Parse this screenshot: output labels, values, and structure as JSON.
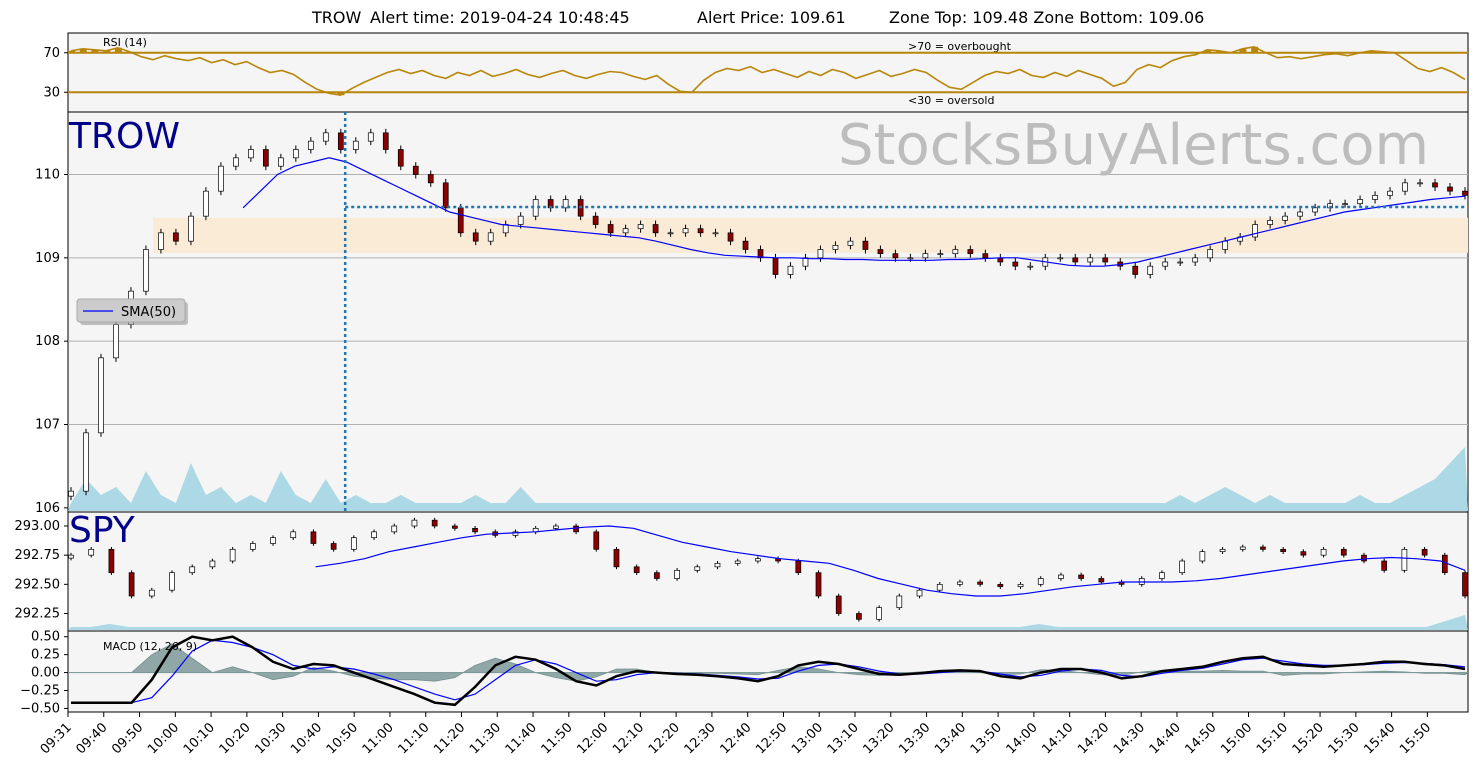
{
  "header": {
    "symbol": "TROW",
    "alert_time": "Alert time: 2019-04-24 10:48:45",
    "alert_price": "Alert Price: 109.61",
    "zone": "Zone Top: 109.48  Zone Bottom: 109.06"
  },
  "watermark": "StocksBuyAlerts.com",
  "colors": {
    "rsi_line": "#b8860b",
    "sma": "#0000ff",
    "volume": "#add8e6",
    "zone": "#faebd7",
    "alert_line": "#1f77b4",
    "macd_hist": "#7f9a9a",
    "panel_bg": "#f5f5f5"
  },
  "chart_data": [
    {
      "name": "rsi",
      "type": "line",
      "label": "RSI (14)",
      "yticks": [
        "70",
        "30"
      ],
      "ylim": [
        10,
        90
      ],
      "overbought_label": ">70 = overbought",
      "oversold_label": "<30 = oversold",
      "overbought": 70,
      "oversold": 30,
      "values": [
        72,
        74,
        73,
        72,
        75,
        71,
        66,
        63,
        67,
        64,
        62,
        65,
        60,
        63,
        58,
        61,
        55,
        50,
        52,
        48,
        40,
        33,
        29,
        27,
        34,
        40,
        45,
        50,
        53,
        49,
        52,
        47,
        44,
        50,
        47,
        52,
        46,
        49,
        53,
        48,
        45,
        49,
        52,
        47,
        44,
        48,
        51,
        50,
        46,
        43,
        47,
        38,
        31,
        30,
        42,
        50,
        54,
        52,
        56,
        50,
        53,
        49,
        45,
        51,
        47,
        53,
        50,
        44,
        48,
        52,
        46,
        49,
        53,
        50,
        42,
        35,
        33,
        40,
        47,
        51,
        49,
        53,
        47,
        45,
        50,
        46,
        52,
        48,
        44,
        36,
        40,
        53,
        58,
        55,
        62,
        66,
        68,
        73,
        72,
        70,
        74,
        76,
        70,
        65,
        66,
        64,
        66,
        68,
        69,
        67,
        70,
        72,
        71,
        70,
        62,
        54,
        51,
        55,
        50,
        43
      ]
    },
    {
      "name": "trow",
      "type": "candlestick",
      "label": "TROW",
      "yticks": [
        "110",
        "109",
        "108",
        "107",
        "106"
      ],
      "ylim": [
        105.95,
        110.75
      ],
      "zone_top": 109.48,
      "zone_bottom": 109.06,
      "alert_price": 109.61,
      "alert_time": "10:48",
      "legend": "SMA(50)",
      "closes": [
        106.2,
        106.9,
        107.8,
        108.2,
        108.6,
        109.1,
        109.3,
        109.2,
        109.5,
        109.8,
        110.1,
        110.2,
        110.3,
        110.1,
        110.2,
        110.3,
        110.4,
        110.5,
        110.3,
        110.4,
        110.5,
        110.3,
        110.1,
        110.0,
        109.9,
        109.6,
        109.3,
        109.2,
        109.3,
        109.4,
        109.5,
        109.7,
        109.6,
        109.7,
        109.5,
        109.4,
        109.3,
        109.35,
        109.4,
        109.3,
        109.3,
        109.35,
        109.3,
        109.3,
        109.2,
        109.1,
        109.0,
        108.8,
        108.9,
        109.0,
        109.1,
        109.15,
        109.2,
        109.1,
        109.05,
        109.0,
        109.0,
        109.05,
        109.05,
        109.1,
        109.05,
        109.0,
        108.95,
        108.9,
        108.9,
        109.0,
        109.0,
        108.95,
        109.0,
        108.95,
        108.9,
        108.8,
        108.9,
        108.95,
        108.95,
        109.0,
        109.1,
        109.2,
        109.25,
        109.4,
        109.45,
        109.5,
        109.55,
        109.6,
        109.65,
        109.65,
        109.7,
        109.75,
        109.8,
        109.9,
        109.9,
        109.85,
        109.8,
        109.75
      ],
      "sma": [
        null,
        null,
        null,
        null,
        null,
        null,
        null,
        null,
        null,
        null,
        109.6,
        109.8,
        110.0,
        110.1,
        110.15,
        110.2,
        110.15,
        110.05,
        109.95,
        109.85,
        109.75,
        109.65,
        109.55,
        109.5,
        109.45,
        109.4,
        109.38,
        109.36,
        109.34,
        109.32,
        109.3,
        109.28,
        109.26,
        109.24,
        109.2,
        109.15,
        109.1,
        109.06,
        109.03,
        109.02,
        109.01,
        109.0,
        109.0,
        108.99,
        108.99,
        108.98,
        108.98,
        108.97,
        108.97,
        108.97,
        108.97,
        108.98,
        108.98,
        108.99,
        109.0,
        109.0,
        108.97,
        108.94,
        108.91,
        108.9,
        108.9,
        108.92,
        108.95,
        109.0,
        109.05,
        109.1,
        109.15,
        109.2,
        109.25,
        109.3,
        109.35,
        109.4,
        109.45,
        109.5,
        109.55,
        109.58,
        109.61,
        109.64,
        109.67,
        109.7,
        109.72,
        109.74
      ],
      "volume": [
        1,
        4,
        2,
        3,
        1,
        5,
        2,
        1,
        6,
        2,
        3,
        1,
        2,
        1,
        5,
        2,
        1,
        4,
        1,
        2,
        1,
        1,
        2,
        1,
        1,
        1,
        1,
        2,
        1,
        1,
        3,
        1,
        1,
        1,
        1,
        1,
        1,
        1,
        1,
        1,
        1,
        1,
        1,
        1,
        1,
        1,
        1,
        1,
        1,
        1,
        1,
        1,
        1,
        1,
        1,
        1,
        1,
        1,
        1,
        1,
        1,
        1,
        1,
        1,
        1,
        1,
        1,
        1,
        1,
        1,
        1,
        1,
        1,
        1,
        2,
        1,
        2,
        3,
        2,
        1,
        2,
        1,
        1,
        1,
        1,
        1,
        2,
        1,
        1,
        2,
        3,
        4,
        6,
        8
      ]
    },
    {
      "name": "spy",
      "type": "candlestick",
      "label": "SPY",
      "yticks": [
        "293.00",
        "292.75",
        "292.50",
        "292.25"
      ],
      "ylim": [
        292.1,
        293.12
      ],
      "closes": [
        292.75,
        292.8,
        292.6,
        292.4,
        292.45,
        292.6,
        292.65,
        292.7,
        292.8,
        292.85,
        292.9,
        292.95,
        292.85,
        292.8,
        292.9,
        292.95,
        293.0,
        293.05,
        293.0,
        292.98,
        292.95,
        292.92,
        292.95,
        292.98,
        293.0,
        292.95,
        292.8,
        292.65,
        292.6,
        292.55,
        292.62,
        292.65,
        292.68,
        292.7,
        292.72,
        292.7,
        292.6,
        292.4,
        292.25,
        292.2,
        292.3,
        292.4,
        292.45,
        292.5,
        292.52,
        292.5,
        292.48,
        292.5,
        292.55,
        292.58,
        292.55,
        292.52,
        292.5,
        292.55,
        292.6,
        292.7,
        292.78,
        292.8,
        292.82,
        292.8,
        292.78,
        292.75,
        292.8,
        292.75,
        292.7,
        292.62,
        292.8,
        292.75,
        292.6,
        292.4
      ],
      "sma": [
        null,
        null,
        null,
        null,
        null,
        null,
        null,
        null,
        null,
        null,
        292.65,
        292.68,
        292.72,
        292.78,
        292.82,
        292.86,
        292.9,
        292.93,
        292.94,
        292.95,
        292.97,
        292.99,
        293.0,
        292.98,
        292.92,
        292.86,
        292.82,
        292.78,
        292.75,
        292.72,
        292.7,
        292.68,
        292.62,
        292.55,
        292.5,
        292.45,
        292.42,
        292.4,
        292.4,
        292.42,
        292.45,
        292.48,
        292.5,
        292.52,
        292.52,
        292.52,
        292.53,
        292.55,
        292.58,
        292.61,
        292.64,
        292.67,
        292.7,
        292.72,
        292.73,
        292.72,
        292.7,
        292.62
      ],
      "volume": [
        1,
        1,
        2,
        1,
        1,
        1,
        1,
        1,
        1,
        1,
        1,
        1,
        1,
        1,
        1,
        1,
        1,
        1,
        1,
        1,
        1,
        1,
        1,
        1,
        1,
        1,
        1,
        1,
        1,
        1,
        1,
        1,
        1,
        1,
        1,
        1,
        1,
        1,
        1,
        1,
        1,
        1,
        1,
        1,
        1,
        1,
        1,
        1,
        1,
        1,
        2,
        1,
        1,
        1,
        1,
        1,
        1,
        1,
        1,
        1,
        1,
        1,
        1,
        1,
        1,
        1,
        1,
        1,
        1,
        1,
        1,
        3,
        5
      ]
    },
    {
      "name": "macd",
      "type": "line",
      "label": "MACD (12, 26, 9)",
      "yticks": [
        "0.50",
        "0.25",
        "0.00",
        "−0.25",
        "−0.50"
      ],
      "ylim": [
        -0.55,
        0.58
      ],
      "macd": [
        -0.42,
        -0.42,
        -0.42,
        -0.42,
        -0.1,
        0.35,
        0.5,
        0.45,
        0.5,
        0.35,
        0.15,
        0.05,
        0.12,
        0.1,
        0.0,
        -0.1,
        -0.2,
        -0.3,
        -0.42,
        -0.45,
        -0.2,
        0.1,
        0.22,
        0.18,
        0.05,
        -0.12,
        -0.18,
        -0.05,
        0.02,
        0.0,
        -0.02,
        -0.03,
        -0.05,
        -0.08,
        -0.12,
        -0.05,
        0.1,
        0.15,
        0.12,
        0.05,
        -0.02,
        -0.03,
        -0.01,
        0.02,
        0.03,
        0.02,
        -0.05,
        -0.08,
        0.0,
        0.05,
        0.05,
        0.0,
        -0.08,
        -0.05,
        0.02,
        0.05,
        0.08,
        0.15,
        0.2,
        0.22,
        0.12,
        0.1,
        0.08,
        0.1,
        0.12,
        0.15,
        0.15,
        0.12,
        0.1,
        0.05
      ],
      "signal": [
        -0.42,
        -0.42,
        -0.42,
        -0.42,
        -0.35,
        -0.05,
        0.3,
        0.45,
        0.42,
        0.35,
        0.25,
        0.1,
        0.05,
        0.08,
        0.05,
        -0.02,
        -0.1,
        -0.2,
        -0.3,
        -0.38,
        -0.3,
        -0.1,
        0.1,
        0.18,
        0.12,
        0.0,
        -0.12,
        -0.1,
        -0.03,
        0.0,
        -0.01,
        -0.02,
        -0.04,
        -0.06,
        -0.09,
        -0.08,
        0.02,
        0.1,
        0.12,
        0.08,
        0.02,
        -0.02,
        -0.02,
        0.0,
        0.02,
        0.02,
        -0.02,
        -0.06,
        -0.04,
        0.02,
        0.05,
        0.03,
        -0.04,
        -0.06,
        -0.01,
        0.03,
        0.06,
        0.12,
        0.18,
        0.2,
        0.16,
        0.12,
        0.1,
        0.1,
        0.11,
        0.13,
        0.14,
        0.13,
        0.11,
        0.08
      ],
      "hist": [
        0,
        0,
        0,
        0,
        0.25,
        0.4,
        0.2,
        0.0,
        0.08,
        0.0,
        -0.1,
        -0.05,
        0.07,
        0.02,
        -0.05,
        -0.08,
        -0.1,
        -0.1,
        -0.12,
        -0.07,
        0.1,
        0.2,
        0.12,
        0.0,
        -0.07,
        -0.12,
        -0.06,
        0.05,
        0.05,
        0.0,
        -0.01,
        -0.01,
        -0.01,
        -0.02,
        -0.03,
        0.03,
        0.08,
        0.05,
        0.0,
        -0.03,
        -0.04,
        -0.01,
        0.01,
        0.02,
        0.01,
        0.0,
        -0.03,
        -0.02,
        0.04,
        0.03,
        0.0,
        -0.03,
        -0.04,
        0.01,
        0.03,
        0.02,
        0.02,
        0.03,
        0.02,
        0.02,
        -0.04,
        -0.02,
        -0.02,
        0.0,
        0.01,
        0.02,
        0.01,
        -0.01,
        -0.01,
        -0.03
      ]
    }
  ],
  "x_axis": {
    "labels": [
      "09:31",
      "09:40",
      "09:50",
      "10:00",
      "10:10",
      "10:20",
      "10:30",
      "10:40",
      "10:50",
      "11:00",
      "11:10",
      "11:20",
      "11:30",
      "11:40",
      "11:50",
      "12:00",
      "12:10",
      "12:20",
      "12:30",
      "12:40",
      "12:50",
      "13:00",
      "13:10",
      "13:20",
      "13:30",
      "13:40",
      "13:50",
      "14:00",
      "14:10",
      "14:20",
      "14:30",
      "14:40",
      "14:50",
      "15:00",
      "15:10",
      "15:20",
      "15:30",
      "15:40",
      "15:50"
    ]
  }
}
